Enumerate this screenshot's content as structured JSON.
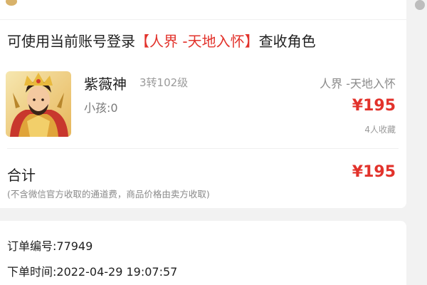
{
  "login_prompt": {
    "prefix": "可使用当前账号登录",
    "server": "【人界 -天地入怀】",
    "suffix": "查收角色"
  },
  "role": {
    "avatar_icon": "character-portrait-icon",
    "name": "紫薇神",
    "level": "3转102级",
    "child": "小孩:0",
    "server": "人界 -天地入怀",
    "price": "¥195",
    "favorites": "4人收藏"
  },
  "total": {
    "label": "合计",
    "price": "¥195",
    "note": "(不含微信官方收取的通道费，商品价格由卖方收取)"
  },
  "order": {
    "number": "订单编号:77949",
    "time": "下单时间:2022-04-29 19:07:57"
  },
  "colors": {
    "accent": "#e2322b",
    "background": "#f2f2f2",
    "card": "#ffffff"
  }
}
